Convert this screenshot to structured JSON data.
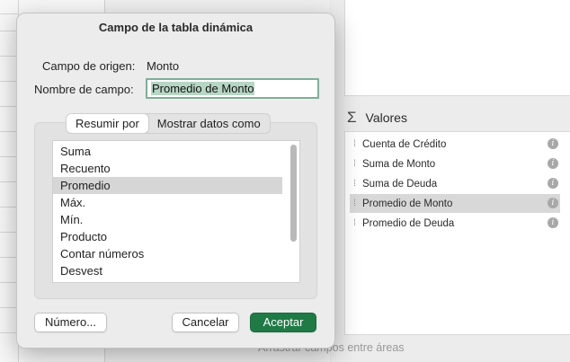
{
  "dialog": {
    "title": "Campo de la tabla dinámica",
    "source_label": "Campo de origen:",
    "source_value": "Monto",
    "name_label": "Nombre de campo:",
    "name_value": "Promedio de Monto",
    "tabs": [
      {
        "label": "Resumir por",
        "active": true
      },
      {
        "label": "Mostrar datos como",
        "active": false
      }
    ],
    "functions": [
      {
        "label": "Suma",
        "selected": false
      },
      {
        "label": "Recuento",
        "selected": false
      },
      {
        "label": "Promedio",
        "selected": true
      },
      {
        "label": "Máx.",
        "selected": false
      },
      {
        "label": "Mín.",
        "selected": false
      },
      {
        "label": "Producto",
        "selected": false
      },
      {
        "label": "Contar números",
        "selected": false
      },
      {
        "label": "Desvest",
        "selected": false
      }
    ],
    "number_button": "Número...",
    "cancel_button": "Cancelar",
    "ok_button": "Aceptar"
  },
  "pivot_panel": {
    "values_title": "Valores",
    "values": [
      {
        "label": "Cuenta de Crédito",
        "selected": false
      },
      {
        "label": "Suma de Monto",
        "selected": false
      },
      {
        "label": "Suma de Deuda",
        "selected": false
      },
      {
        "label": "Promedio de Monto",
        "selected": true
      },
      {
        "label": "Promedio de Deuda",
        "selected": false
      }
    ],
    "drag_hint": "Arrastrar campos entre áreas"
  },
  "colors": {
    "accent": "#1f7a46",
    "input_focus": "#7fae97",
    "selection": "#d6d6d6"
  },
  "icons": [
    "sigma-icon",
    "info-icon",
    "grip-icon"
  ]
}
